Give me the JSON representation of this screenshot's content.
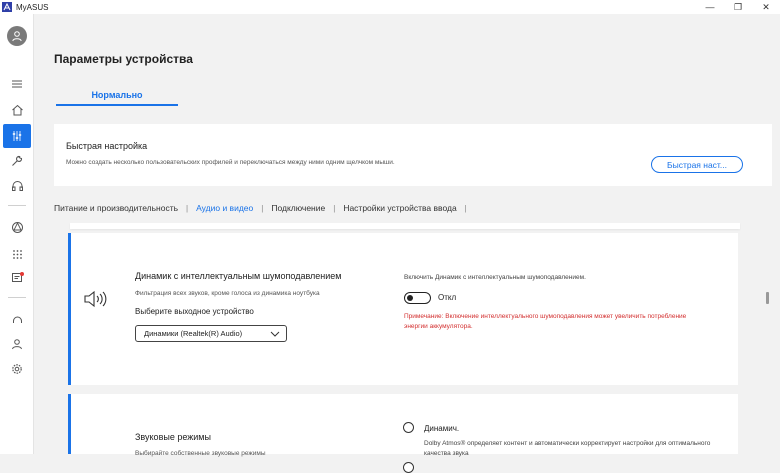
{
  "window": {
    "app_title": "MyASUS",
    "controls": {
      "minimize": "—",
      "restore": "❐",
      "close": "✕"
    }
  },
  "sidebar": {
    "icons": [
      "avatar-icon",
      "menu-icon",
      "home-icon",
      "device-settings-icon",
      "wrench-icon",
      "headset-icon",
      "store-icon",
      "apps-grid-icon",
      "news-icon",
      "support-icon",
      "account-icon",
      "settings-icon"
    ],
    "active_item": "device-settings-icon"
  },
  "page": {
    "title": "Параметры устройства",
    "mode_tab": "Нормально"
  },
  "quick_setup": {
    "title": "Быстрая настройка",
    "description": "Можно создать несколько пользовательских профилей и переключаться между ними одним щелчком мыши.",
    "button_label": "Быстрая наст..."
  },
  "subnav": {
    "items": [
      {
        "label": "Питание и производительность"
      },
      {
        "label": "Аудио и видео"
      },
      {
        "label": "Подключение"
      },
      {
        "label": "Настройки устройства ввода"
      }
    ],
    "active_index": 1,
    "separator": "|"
  },
  "noise_cancel_card": {
    "title": "Динамик с интеллектуальным шумоподавлением",
    "description": "Фильтрация всех звуков, кроме голоса из динамика ноутбука",
    "output_label": "Выберите выходное устройство",
    "output_value": "Динамики (Realtek(R) Audio)",
    "toggle_desc": "Включить Динамик с интеллектуальным шумоподавлением.",
    "toggle_label": "Откл",
    "toggle_on": false,
    "note": "Примечание: Включение интеллектуального шумоподавления может увеличить потребление энергии аккумулятора."
  },
  "sound_modes_card": {
    "title": "Звуковые режимы",
    "description": "Выбирайте собственные звуковые режимы",
    "option1_label": "Динамич.",
    "option1_desc": "Dolby Atmos® определяет контент и автоматически корректирует настройки для оптимального качества звука"
  },
  "colors": {
    "accent": "#1a73e8",
    "warning_text": "#d32f2f",
    "background": "#f2f2f2"
  }
}
